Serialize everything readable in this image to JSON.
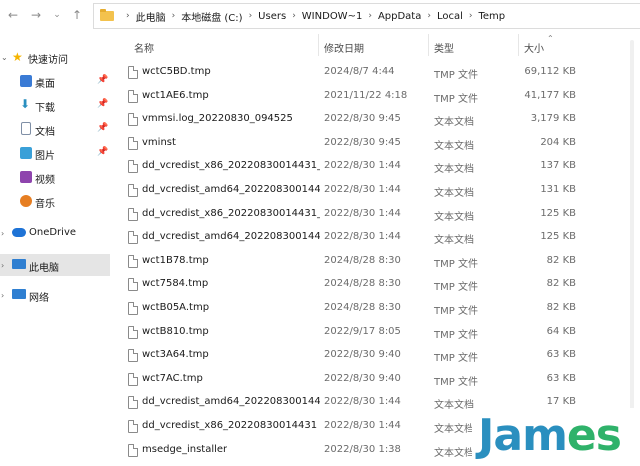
{
  "breadcrumb": [
    "此电脑",
    "本地磁盘 (C:)",
    "Users",
    "WINDOW~1",
    "AppData",
    "Local",
    "Temp"
  ],
  "sidebar": {
    "items": [
      {
        "label": "快速访问",
        "icon": "star-icon",
        "color": "#f5b400",
        "pinned": false
      },
      {
        "label": "桌面",
        "icon": "desktop-icon",
        "color": "#3a7bd5",
        "pinned": true
      },
      {
        "label": "下载",
        "icon": "download-icon",
        "color": "#2a8fbf",
        "pinned": true
      },
      {
        "label": "文档",
        "icon": "document-icon",
        "color": "#7f8fa6",
        "pinned": true
      },
      {
        "label": "图片",
        "icon": "picture-icon",
        "color": "#3aa0d8",
        "pinned": true
      },
      {
        "label": "视频",
        "icon": "video-icon",
        "color": "#8e44ad",
        "pinned": false
      },
      {
        "label": "音乐",
        "icon": "music-icon",
        "color": "#e67e22",
        "pinned": false
      },
      {
        "label": "OneDrive",
        "icon": "cloud-icon",
        "color": "#1e73d6",
        "pinned": false
      },
      {
        "label": "此电脑",
        "icon": "computer-icon",
        "color": "#2f7fd1",
        "pinned": false
      },
      {
        "label": "网络",
        "icon": "network-icon",
        "color": "#2f7fd1",
        "pinned": false
      }
    ]
  },
  "columns": {
    "name": "名称",
    "date": "修改日期",
    "type": "类型",
    "size": "大小"
  },
  "files": [
    {
      "name": "wctC5BD.tmp",
      "date": "2024/8/7 4:44",
      "type": "TMP 文件",
      "size": "69,112 KB"
    },
    {
      "name": "wct1AE6.tmp",
      "date": "2021/11/22 4:18",
      "type": "TMP 文件",
      "size": "41,177 KB"
    },
    {
      "name": "vmmsi.log_20220830_094525",
      "date": "2022/8/30 9:45",
      "type": "文本文档",
      "size": "3,179 KB"
    },
    {
      "name": "vminst",
      "date": "2022/8/30 9:45",
      "type": "文本文档",
      "size": "204 KB"
    },
    {
      "name": "dd_vcredist_x86_20220830014431_00...",
      "date": "2022/8/30 1:44",
      "type": "文本文档",
      "size": "137 KB"
    },
    {
      "name": "dd_vcredist_amd64_20220830014437...",
      "date": "2022/8/30 1:44",
      "type": "文本文档",
      "size": "131 KB"
    },
    {
      "name": "dd_vcredist_x86_20220830014431_00...",
      "date": "2022/8/30 1:44",
      "type": "文本文档",
      "size": "125 KB"
    },
    {
      "name": "dd_vcredist_amd64_20220830014437...",
      "date": "2022/8/30 1:44",
      "type": "文本文档",
      "size": "125 KB"
    },
    {
      "name": "wct1B78.tmp",
      "date": "2024/8/28 8:30",
      "type": "TMP 文件",
      "size": "82 KB"
    },
    {
      "name": "wct7584.tmp",
      "date": "2024/8/28 8:30",
      "type": "TMP 文件",
      "size": "82 KB"
    },
    {
      "name": "wctB05A.tmp",
      "date": "2024/8/28 8:30",
      "type": "TMP 文件",
      "size": "82 KB"
    },
    {
      "name": "wctB810.tmp",
      "date": "2022/9/17 8:05",
      "type": "TMP 文件",
      "size": "64 KB"
    },
    {
      "name": "wct3A64.tmp",
      "date": "2022/8/30 9:40",
      "type": "TMP 文件",
      "size": "63 KB"
    },
    {
      "name": "wct7AC.tmp",
      "date": "2022/8/30 9:40",
      "type": "TMP 文件",
      "size": "63 KB"
    },
    {
      "name": "dd_vcredist_amd64_20220830014437",
      "date": "2022/8/30 1:44",
      "type": "文本文档",
      "size": "17 KB"
    },
    {
      "name": "dd_vcredist_x86_20220830014431",
      "date": "2022/8/30 1:44",
      "type": "文本文档",
      "size": ""
    },
    {
      "name": "msedge_installer",
      "date": "2022/8/30 1:38",
      "type": "文本文档",
      "size": ""
    }
  ],
  "watermark": {
    "text_a": "Jam",
    "text_b": "es"
  }
}
